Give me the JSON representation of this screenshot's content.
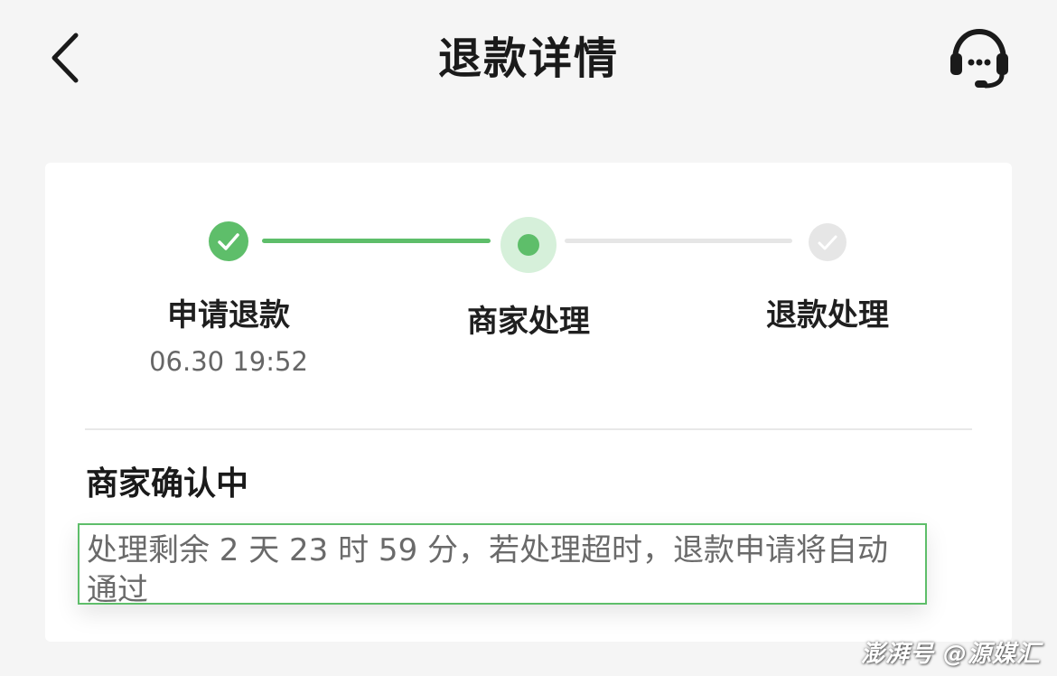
{
  "header": {
    "title": "退款详情",
    "back_icon": "chevron-left-icon",
    "service_icon": "headset-icon"
  },
  "progress": {
    "steps": [
      {
        "label": "申请退款",
        "time": "06.30 19:52",
        "state": "completed",
        "icon": "check-circle-icon"
      },
      {
        "label": "商家处理",
        "state": "current",
        "icon": "dot-circle-icon"
      },
      {
        "label": "退款处理",
        "state": "pending",
        "icon": "check-circle-icon"
      }
    ],
    "colors": {
      "active": "#5ebe6a",
      "active_halo": "#d6f0da",
      "inactive": "#e6e6e6"
    }
  },
  "status": {
    "title": "商家确认中",
    "description": "处理剩余 2 天 23 时 59 分，若处理超时，退款申请将自动通过"
  },
  "watermark": "澎湃号 @源媒汇"
}
